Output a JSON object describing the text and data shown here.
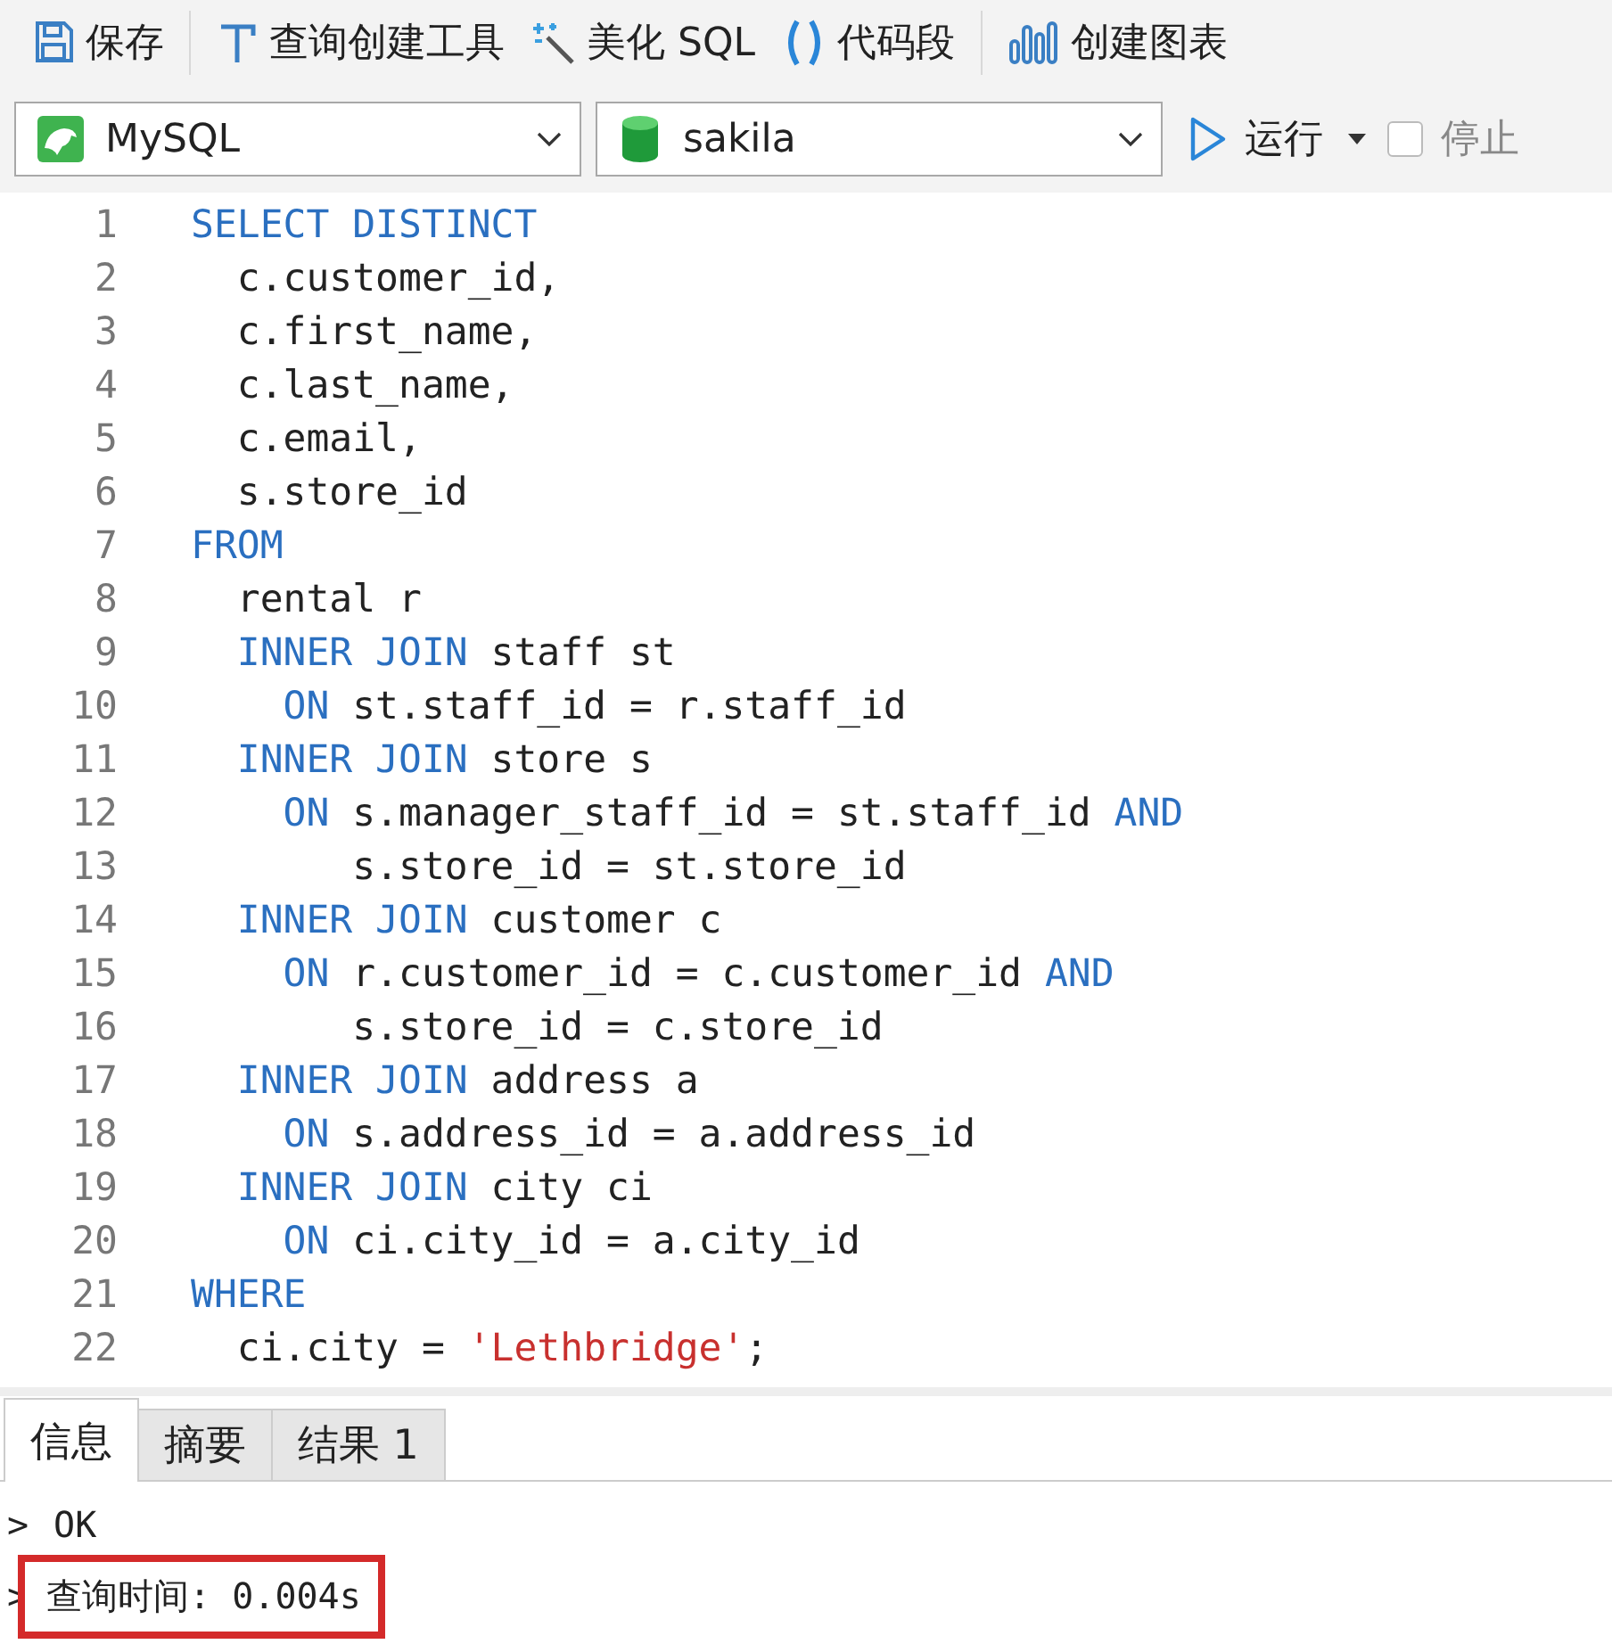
{
  "toolbar": {
    "groups": [
      [
        {
          "kind": "save",
          "label": "保存"
        }
      ],
      [
        {
          "kind": "builder",
          "label": "查询创建工具"
        },
        {
          "kind": "beautify",
          "label": "美化 SQL"
        },
        {
          "kind": "snippet",
          "label": "代码段"
        }
      ],
      [
        {
          "kind": "chart",
          "label": "创建图表"
        }
      ]
    ]
  },
  "connection": {
    "kind": "dolphin",
    "value": "MySQL"
  },
  "database": {
    "kind": "database",
    "value": "sakila"
  },
  "run": {
    "label": "运行"
  },
  "stop": {
    "label": "停止",
    "checked": false,
    "disabled": true
  },
  "editor": {
    "lines": [
      {
        "number": "1",
        "tokens": [
          {
            "kind": "keyword",
            "text": "SELECT DISTINCT"
          }
        ]
      },
      {
        "number": "2",
        "tokens": [
          {
            "kind": "plain",
            "text": "  c.customer_id,"
          }
        ]
      },
      {
        "number": "3",
        "tokens": [
          {
            "kind": "plain",
            "text": "  c.first_name,"
          }
        ]
      },
      {
        "number": "4",
        "tokens": [
          {
            "kind": "plain",
            "text": "  c.last_name,"
          }
        ]
      },
      {
        "number": "5",
        "tokens": [
          {
            "kind": "plain",
            "text": "  c.email,"
          }
        ]
      },
      {
        "number": "6",
        "tokens": [
          {
            "kind": "plain",
            "text": "  s.store_id"
          }
        ]
      },
      {
        "number": "7",
        "tokens": [
          {
            "kind": "keyword",
            "text": "FROM"
          }
        ]
      },
      {
        "number": "8",
        "tokens": [
          {
            "kind": "plain",
            "text": "  rental r"
          }
        ]
      },
      {
        "number": "9",
        "tokens": [
          {
            "kind": "keyword",
            "text": "  INNER JOIN"
          },
          {
            "kind": "plain",
            "text": " staff st"
          }
        ]
      },
      {
        "number": "10",
        "tokens": [
          {
            "kind": "keyword",
            "text": "    ON"
          },
          {
            "kind": "plain",
            "text": " st.staff_id = r.staff_id"
          }
        ]
      },
      {
        "number": "11",
        "tokens": [
          {
            "kind": "keyword",
            "text": "  INNER JOIN"
          },
          {
            "kind": "plain",
            "text": " store s"
          }
        ]
      },
      {
        "number": "12",
        "tokens": [
          {
            "kind": "keyword",
            "text": "    ON"
          },
          {
            "kind": "plain",
            "text": " s.manager_staff_id = st.staff_id "
          },
          {
            "kind": "keyword",
            "text": "AND"
          }
        ]
      },
      {
        "number": "13",
        "tokens": [
          {
            "kind": "plain",
            "text": "       s.store_id = st.store_id"
          }
        ]
      },
      {
        "number": "14",
        "tokens": [
          {
            "kind": "keyword",
            "text": "  INNER JOIN"
          },
          {
            "kind": "plain",
            "text": " customer c"
          }
        ]
      },
      {
        "number": "15",
        "tokens": [
          {
            "kind": "keyword",
            "text": "    ON"
          },
          {
            "kind": "plain",
            "text": " r.customer_id = c.customer_id "
          },
          {
            "kind": "keyword",
            "text": "AND"
          }
        ]
      },
      {
        "number": "16",
        "tokens": [
          {
            "kind": "plain",
            "text": "       s.store_id = c.store_id"
          }
        ]
      },
      {
        "number": "17",
        "tokens": [
          {
            "kind": "keyword",
            "text": "  INNER JOIN"
          },
          {
            "kind": "plain",
            "text": " address a"
          }
        ]
      },
      {
        "number": "18",
        "tokens": [
          {
            "kind": "keyword",
            "text": "    ON"
          },
          {
            "kind": "plain",
            "text": " s.address_id = a.address_id"
          }
        ]
      },
      {
        "number": "19",
        "tokens": [
          {
            "kind": "keyword",
            "text": "  INNER JOIN"
          },
          {
            "kind": "plain",
            "text": " city ci"
          }
        ]
      },
      {
        "number": "20",
        "tokens": [
          {
            "kind": "keyword",
            "text": "    ON"
          },
          {
            "kind": "plain",
            "text": " ci.city_id = a.city_id"
          }
        ]
      },
      {
        "number": "21",
        "tokens": [
          {
            "kind": "keyword",
            "text": "WHERE"
          }
        ]
      },
      {
        "number": "22",
        "tokens": [
          {
            "kind": "plain",
            "text": "  ci.city = "
          },
          {
            "kind": "string",
            "text": "'Lethbridge'"
          },
          {
            "kind": "plain",
            "text": ";"
          }
        ]
      }
    ]
  },
  "result_tabs": [
    {
      "label": "信息",
      "selected": true
    },
    {
      "label": "摘要",
      "selected": false
    },
    {
      "label": "结果 1",
      "selected": false
    }
  ],
  "messages": [
    {
      "prompt": ">",
      "text": "OK",
      "highlighted": false
    },
    {
      "prompt": ">",
      "text": "查询时间: 0.004s",
      "highlighted": true
    }
  ]
}
